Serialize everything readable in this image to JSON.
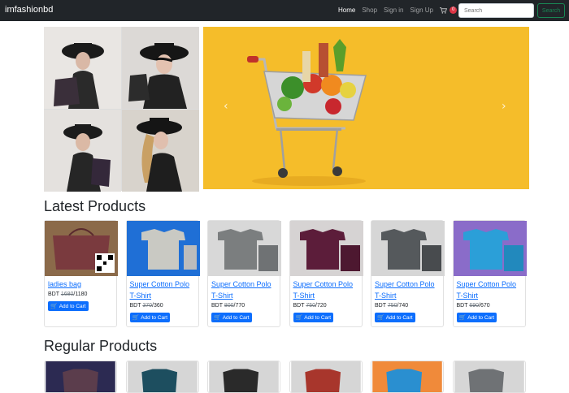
{
  "navbar": {
    "brand": "imfashionbd",
    "links": [
      "Home",
      "Shop",
      "Sign in",
      "Sign Up"
    ],
    "cart_count": "0",
    "search_placeholder": "Search",
    "search_button": "Search"
  },
  "carousel": {
    "prev_icon": "chevron-left-icon",
    "next_icon": "chevron-right-icon"
  },
  "sections": {
    "latest": "Latest Products",
    "regular": "Regular Products"
  },
  "latest_products": [
    {
      "title": "ladies bag",
      "currency": "BDT",
      "old_price": "1680",
      "price": "1180",
      "button": "Add to Cart",
      "image_color": "#7a3a3e"
    },
    {
      "title": "Super Cotton Polo T-Shirt",
      "currency": "BDT",
      "old_price": "370",
      "price": "360",
      "button": "Add to Cart",
      "image_color": "#c9c9c3"
    },
    {
      "title": "Super Cotton Polo T-Shirt",
      "currency": "BDT",
      "old_price": "800",
      "price": "770",
      "button": "Add to Cart",
      "image_color": "#7b7e7f"
    },
    {
      "title": "Super Cotton Polo T-Shirt",
      "currency": "BDT",
      "old_price": "750",
      "price": "720",
      "button": "Add to Cart",
      "image_color": "#5c1d3a"
    },
    {
      "title": "Super Cotton Polo T-Shirt",
      "currency": "BDT",
      "old_price": "750",
      "price": "740",
      "button": "Add to Cart",
      "image_color": "#55595c"
    },
    {
      "title": "Super Cotton Polo T-Shirt",
      "currency": "BDT",
      "old_price": "690",
      "price": "670",
      "button": "Add to Cart",
      "image_color": "#2b9fd8"
    }
  ],
  "regular_products": [
    {
      "image_color": "#5b3d4c"
    },
    {
      "image_color": "#1d4e5f"
    },
    {
      "image_color": "#2a2a2a"
    },
    {
      "image_color": "#a8362c"
    },
    {
      "image_color": "#2a8fd0"
    },
    {
      "image_color": "#6f7275"
    }
  ],
  "colors": {
    "navbar_bg": "#212529",
    "primary": "#0d6efd",
    "success": "#198754",
    "badge": "#dc3545",
    "hero_yellow": "#f5bd2a"
  }
}
